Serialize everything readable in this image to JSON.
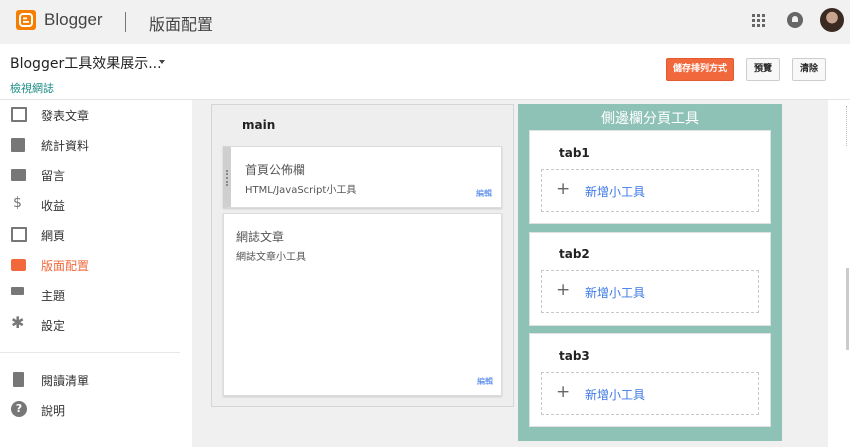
{
  "app": {
    "brand": "Blogger",
    "page_title": "版面配置",
    "colors": {
      "accent": "#f1683c",
      "teal": "#8fc2b6",
      "link": "#3b78e7",
      "logo": "#f57d00"
    }
  },
  "header": {
    "blog_name": "Blogger工具效果展示...",
    "view_blog": "檢視網誌",
    "buttons": {
      "save": "儲存排列方式",
      "preview": "預覽",
      "clear": "清除"
    }
  },
  "sidebar": {
    "items": [
      {
        "label": "發表文章",
        "icon": "posts-icon"
      },
      {
        "label": "統計資料",
        "icon": "stats-icon"
      },
      {
        "label": "留言",
        "icon": "comments-icon"
      },
      {
        "label": "收益",
        "icon": "dollar-icon"
      },
      {
        "label": "網頁",
        "icon": "pages-icon"
      },
      {
        "label": "版面配置",
        "icon": "layout-icon",
        "active": true
      },
      {
        "label": "主題",
        "icon": "paint-roller-icon"
      },
      {
        "label": "設定",
        "icon": "gear-icon"
      }
    ],
    "secondary": [
      {
        "label": "閱讀清單",
        "icon": "bookmark-icon"
      },
      {
        "label": "說明",
        "icon": "help-icon"
      }
    ]
  },
  "layout": {
    "main_section": {
      "title": "main",
      "gadgets": [
        {
          "title": "首頁公佈欄",
          "subtitle": "HTML/JavaScript小工具",
          "edit": "編輯"
        },
        {
          "title": "網誌文章",
          "subtitle": "網誌文章小工具",
          "edit": "編輯"
        }
      ]
    },
    "side_section": {
      "title": "側邊欄分頁工具",
      "tabs": [
        {
          "label": "tab1",
          "add_label": "新增小工具"
        },
        {
          "label": "tab2",
          "add_label": "新增小工具"
        },
        {
          "label": "tab3",
          "add_label": "新增小工具"
        }
      ]
    }
  }
}
